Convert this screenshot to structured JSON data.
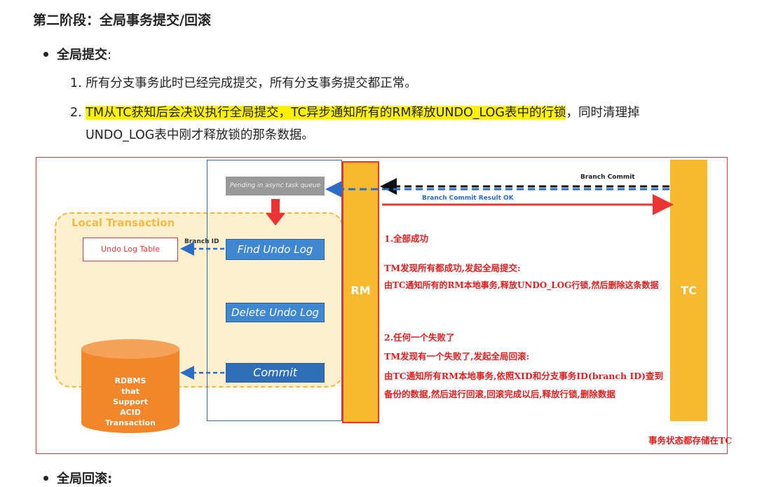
{
  "heading": "第二阶段：全局事务提交/回滚",
  "bullet": {
    "label": "全局提交",
    "colon": ":"
  },
  "list": [
    {
      "num": "1.",
      "text": "所有分支事务此时已经完成提交，所有分支事务提交都正常。"
    },
    {
      "num": "2.",
      "highlight": "TM从TC获知后会决议执行全局提交，TC异步通知所有的RM释放UNDO_LOG表中的行锁",
      "rest": "，同时清理掉",
      "line2": "UNDO_LOG表中刚才释放锁的那条数据。"
    }
  ],
  "diagram": {
    "local_transaction": "Local Transaction",
    "pending": "Pending in async task queue",
    "find_undo": "Find Undo Log",
    "delete_undo": "Delete Undo Log",
    "commit": "Commit",
    "undo_table": "Undo Log Table",
    "branch_id": "Branch ID",
    "rdbms": [
      "RDBMS",
      "that",
      "Support",
      "ACID",
      "Transaction"
    ],
    "rm": "RM",
    "tc": "TC",
    "branch_commit": "Branch Commit",
    "branch_commit_result": "Branch Commit Result OK",
    "notes": [
      "1.全部成功",
      "TM发现所有都成功,发起全局提交:",
      "由TC通知所有的RM本地事务,释放UNDO_LOG行锁,然后删除这条数据",
      "2.任何一个失败了",
      "TM发现有一个失败了,发起全局回滚:",
      "由TC通知所有RM本地事务,依照XID和分支事务ID(branch ID)查到",
      "备份的数据,然后进行回滚,回滚完成以后,释放行锁,删除数据"
    ],
    "footer_note": "事务状态都存储在TC"
  },
  "next_bullet": "全局回滚:"
}
